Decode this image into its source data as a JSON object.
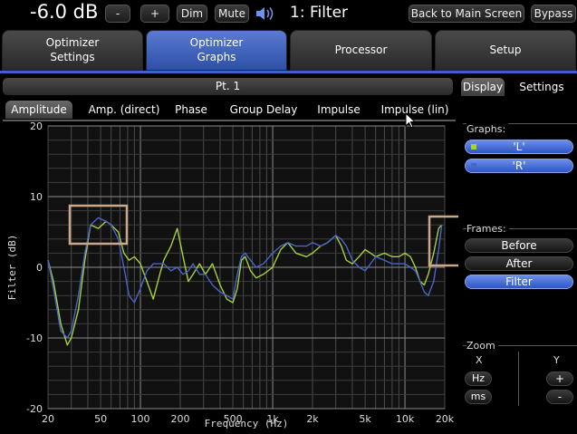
{
  "header": {
    "volume": "-6.0 dB",
    "minus": "-",
    "plus": "+",
    "dim": "Dim",
    "mute": "Mute",
    "preset": "1: Filter",
    "back": "Back to Main Screen",
    "bypass": "Bypass"
  },
  "main_tabs": [
    {
      "line1": "Optimizer",
      "line2": "Settings"
    },
    {
      "line1": "Optimizer",
      "line2": "Graphs"
    },
    {
      "line1": "Processor",
      "line2": ""
    },
    {
      "line1": "Setup",
      "line2": ""
    }
  ],
  "point_bar": "Pt. 1",
  "right_tabs": {
    "display": "Display",
    "settings": "Settings"
  },
  "graph_tabs": [
    "Amplitude",
    "Amp. (direct)",
    "Phase",
    "Group Delay",
    "Impulse",
    "Impulse (lin)"
  ],
  "graphs_panel": {
    "title": "Graphs:",
    "l": "'L'",
    "r": "'R'"
  },
  "frames_panel": {
    "title": "Frames:",
    "before": "Before",
    "after": "After",
    "filter": "Filter"
  },
  "zoom_panel": {
    "title": "Zoom",
    "x": "X",
    "y": "Y",
    "hz": "Hz",
    "ms": "ms",
    "plus": "+",
    "minus": "-"
  },
  "colors": {
    "series_green": "#a6d13a",
    "series_blue": "#4a64c8",
    "highlight_box": "#c9a98a",
    "accent_blue": "#3a62c8"
  },
  "chart_data": {
    "type": "line",
    "xlabel": "Frequency (Hz)",
    "ylabel": "Filter (dB)",
    "xscale": "log",
    "xlim": [
      20,
      20000
    ],
    "ylim": [
      -20,
      20
    ],
    "xticks": [
      "20",
      "50",
      "100",
      "200",
      "500",
      "1k",
      "2k",
      "5k",
      "10k",
      "20k"
    ],
    "yticks": [
      "20",
      "10",
      "0",
      "-10",
      "-20"
    ],
    "grid": true,
    "series": [
      {
        "name": "'L'",
        "color": "#a6d13a",
        "x": [
          20,
          22,
          25,
          28,
          30,
          34,
          38,
          42,
          48,
          55,
          60,
          68,
          75,
          82,
          90,
          100,
          112,
          125,
          140,
          150,
          170,
          190,
          210,
          230,
          250,
          280,
          310,
          350,
          400,
          450,
          500,
          540,
          580,
          620,
          680,
          750,
          850,
          1000,
          1150,
          1300,
          1500,
          1800,
          2000,
          2300,
          2600,
          3000,
          3300,
          3600,
          4000,
          4500,
          5000,
          5500,
          6000,
          7000,
          8000,
          9000,
          10000,
          11000,
          12000,
          13000,
          14000,
          15000,
          16500,
          18000,
          19000
        ],
        "y": [
          1,
          -2,
          -8,
          -11,
          -10,
          -6,
          1,
          6,
          5.5,
          6.5,
          6,
          5,
          2,
          1,
          1.5,
          0.5,
          -2,
          -4.5,
          -1,
          1,
          3,
          5.5,
          1.5,
          -2,
          -1,
          0.5,
          -1,
          0.5,
          -2.5,
          -4.5,
          -5,
          -3,
          1,
          1.5,
          -0.5,
          -1.5,
          -1,
          0,
          2.5,
          3.5,
          2,
          1.5,
          2,
          3,
          3.5,
          4.5,
          3,
          1,
          0.5,
          1.5,
          2.5,
          2,
          1.5,
          2,
          1.5,
          1.5,
          2,
          1.5,
          0,
          -2,
          -2.5,
          -1,
          2,
          5.5,
          6
        ]
      },
      {
        "name": "'R'",
        "color": "#4a64c8",
        "x": [
          20,
          22,
          25,
          28,
          30,
          34,
          38,
          42,
          48,
          55,
          60,
          68,
          75,
          82,
          90,
          100,
          112,
          125,
          140,
          150,
          170,
          190,
          210,
          230,
          250,
          280,
          310,
          350,
          400,
          450,
          500,
          540,
          580,
          620,
          680,
          750,
          850,
          1000,
          1150,
          1300,
          1500,
          1800,
          2000,
          2300,
          2600,
          3000,
          3300,
          3600,
          4000,
          4500,
          5000,
          5500,
          6000,
          7000,
          8000,
          9000,
          10000,
          11000,
          12000,
          13000,
          14000,
          15000,
          16500,
          18000,
          19000
        ],
        "y": [
          1,
          -3,
          -9,
          -10,
          -9,
          -4,
          2,
          6,
          7,
          6.5,
          6,
          4,
          0,
          -4,
          -5,
          -3,
          -0.5,
          0.5,
          0.5,
          0.5,
          -0.5,
          0,
          -1,
          -0.5,
          0.5,
          -1,
          -1,
          -2.5,
          -3.5,
          -4,
          -4.5,
          -1,
          1.5,
          2,
          1,
          0,
          0.5,
          2,
          3,
          3.5,
          3,
          3,
          3.5,
          3,
          3.5,
          4.5,
          4,
          3,
          1,
          0,
          -0.5,
          0.5,
          1.5,
          1,
          0.5,
          0.5,
          0.5,
          0,
          -0.5,
          -2,
          -3.5,
          -4,
          -2,
          2.5,
          6
        ]
      }
    ]
  }
}
